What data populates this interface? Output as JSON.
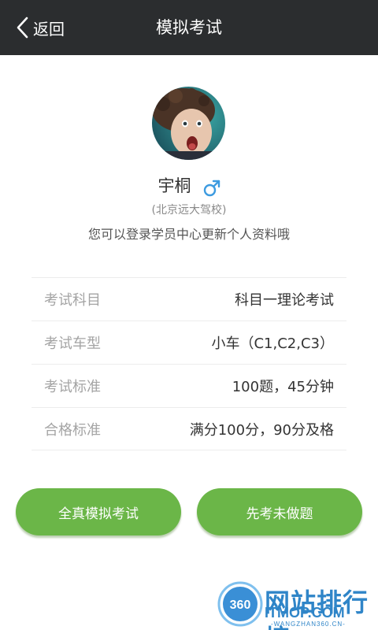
{
  "header": {
    "back_label": "返回",
    "title": "模拟考试"
  },
  "profile": {
    "name": "宇桐",
    "gender": "male",
    "school": "(北京远大驾校)",
    "hint": "您可以登录学员中心更新个人资料哦"
  },
  "exam_info": [
    {
      "label": "考试科目",
      "value": "科目一理论考试"
    },
    {
      "label": "考试车型",
      "value": "小车（C1,C2,C3）"
    },
    {
      "label": "考试标准",
      "value": "100题，45分钟"
    },
    {
      "label": "合格标准",
      "value": "满分100分，90分及格"
    }
  ],
  "buttons": {
    "full_mock": "全真模拟考试",
    "practice_first": "先考未做题"
  },
  "watermark": {
    "badge": "360",
    "main": "网站排行榜",
    "domain": "ITMOP.COM",
    "sub": "-WANGZHAN360.CN-"
  },
  "colors": {
    "header_bg": "#2b2d2f",
    "button_green": "#6bb648",
    "gender_blue": "#3d9be0"
  }
}
